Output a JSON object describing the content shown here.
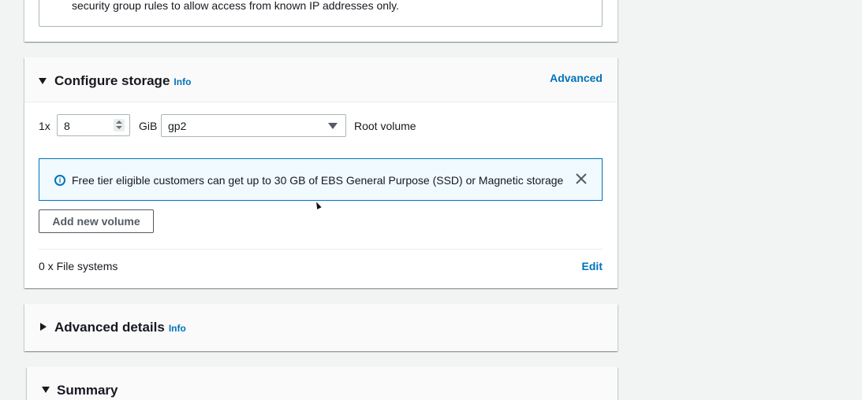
{
  "network_panel": {
    "notice_text": "security group rules to allow access from known IP addresses only."
  },
  "storage": {
    "title": "Configure storage",
    "info_label": "Info",
    "advanced_label": "Advanced",
    "volume": {
      "count_label": "1x",
      "size_value": "8",
      "unit_label": "GiB",
      "type_value": "gp2",
      "root_label": "Root volume"
    },
    "alert": {
      "icon": "info-circle-icon",
      "text": "Free tier eligible customers can get up to 30 GB of EBS General Purpose (SSD) or Magnetic storage"
    },
    "add_volume_label": "Add new volume",
    "file_systems_label": "0 x File systems",
    "edit_label": "Edit"
  },
  "advanced_details": {
    "title": "Advanced details",
    "info_label": "Info"
  },
  "summary": {
    "title": "Summary"
  },
  "colors": {
    "link": "#0073bb",
    "alert_bg": "#f1faff",
    "alert_border": "#0073bb",
    "text": "#16191f"
  }
}
